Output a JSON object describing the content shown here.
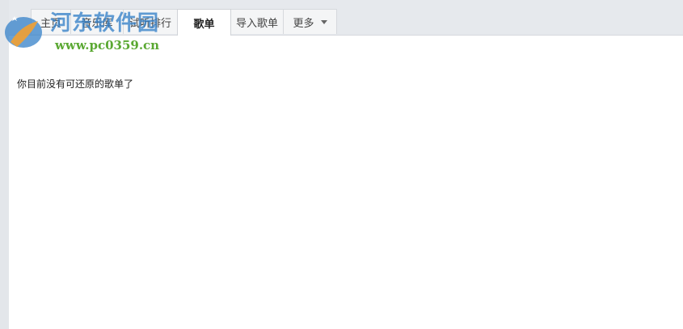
{
  "tabs": [
    {
      "label": "主页",
      "active": false
    },
    {
      "label": "音乐库",
      "active": false
    },
    {
      "label": "试听排行",
      "active": false
    },
    {
      "label": "歌单",
      "active": true
    },
    {
      "label": "导入歌单",
      "active": false
    },
    {
      "label": "更多",
      "active": false,
      "dropdown": true
    }
  ],
  "content": {
    "empty_message": "你目前没有可还原的歌单了"
  },
  "watermark": {
    "title": "河东软件园",
    "url": "www.pc0359.cn"
  },
  "colors": {
    "tab_bar_bg": "#e6e9ed",
    "active_tab_bg": "#ffffff",
    "watermark_blue": "#3480c8",
    "watermark_green": "#5aa832"
  }
}
